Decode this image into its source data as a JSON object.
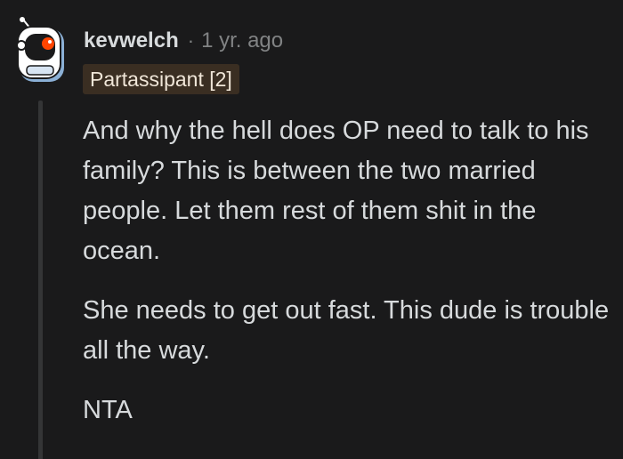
{
  "comment": {
    "username": "kevwelch",
    "separator": "·",
    "timestamp": "1 yr. ago",
    "flair": "Partassipant [2]",
    "paragraphs": [
      "And why the hell does OP need to talk to his family? This is between the two married people. Let them rest of them shit in the ocean.",
      "She needs to get out fast. This dude is trouble all the way.",
      "NTA"
    ]
  },
  "avatar": {
    "icon": "snoo-robot-avatar",
    "accent_color": "#ff4500",
    "body_color": "#ffffff",
    "outline_color": "#1a1a1b",
    "shadow_color": "#8bb0d6"
  },
  "colors": {
    "background": "#1a1a1b",
    "text": "#d7dadc",
    "meta": "#818384",
    "flair_bg": "#3a2e22",
    "thread_line": "#343536"
  }
}
